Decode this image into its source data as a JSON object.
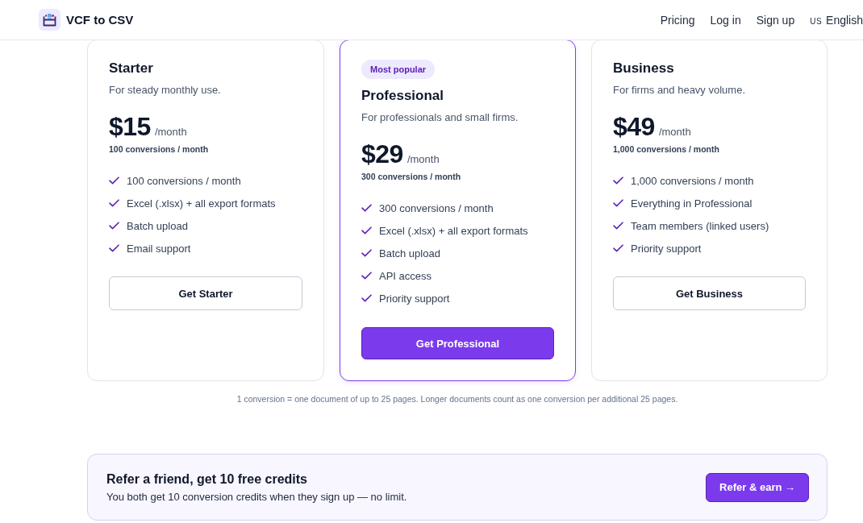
{
  "header": {
    "brand": "VCF to CSV",
    "nav": [
      {
        "label": "Pricing"
      },
      {
        "label": "Log in"
      },
      {
        "label": "Sign up"
      }
    ],
    "language": {
      "flag": "US",
      "label": "English"
    }
  },
  "plans": [
    {
      "name": "Starter",
      "tagline": "For steady monthly use.",
      "price": "$15",
      "period": "/month",
      "quota": "100 conversions / month",
      "features": [
        "100 conversions / month",
        "Excel (.xlsx) + all export formats",
        "Batch upload",
        "Email support"
      ],
      "button": "Get Starter",
      "highlighted": false
    },
    {
      "badge": "Most popular",
      "name": "Professional",
      "tagline": "For professionals and small firms.",
      "price": "$29",
      "period": "/month",
      "quota": "300 conversions / month",
      "features": [
        "300 conversions / month",
        "Excel (.xlsx) + all export formats",
        "Batch upload",
        "API access",
        "Priority support"
      ],
      "button": "Get Professional",
      "highlighted": true
    },
    {
      "name": "Business",
      "tagline": "For firms and heavy volume.",
      "price": "$49",
      "period": "/month",
      "quota": "1,000 conversions / month",
      "features": [
        "1,000 conversions / month",
        "Everything in Professional",
        "Team members (linked users)",
        "Priority support"
      ],
      "button": "Get Business",
      "highlighted": false
    }
  ],
  "footnote": "1 conversion = one document of up to 25 pages. Longer documents count as one conversion per additional 25 pages.",
  "referral": {
    "title": "Refer a friend, get 10 free credits",
    "text": "You both get 10 conversion credits when they sign up — no limit.",
    "button": "Refer & earn →"
  }
}
